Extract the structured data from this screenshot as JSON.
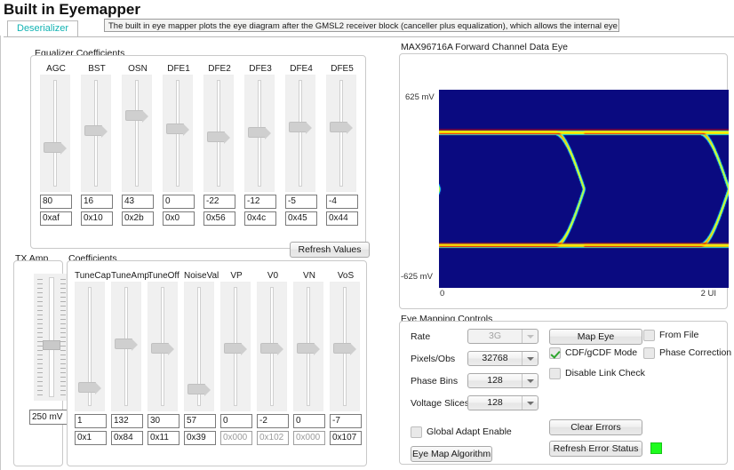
{
  "window": {
    "title": "Built in Eyemapper"
  },
  "tabs": [
    {
      "label": "Deserializer",
      "active": true
    }
  ],
  "description": "The built in eye mapper plots the eye diagram after the GMSL2 receiver block (canceller plus equalization), which allows the internal eye to be shown.",
  "equalizer": {
    "group_label": "Equalizer Coefficients",
    "channels": [
      {
        "name": "AGC",
        "dec": "80",
        "hex": "0xaf",
        "thumb_pct": 62
      },
      {
        "name": "BST",
        "dec": "16",
        "hex": "0x10",
        "thumb_pct": 46
      },
      {
        "name": "OSN",
        "dec": "43",
        "hex": "0x2b",
        "thumb_pct": 31
      },
      {
        "name": "DFE1",
        "dec": "0",
        "hex": "0x0",
        "thumb_pct": 44
      },
      {
        "name": "DFE2",
        "dec": "-22",
        "hex": "0x56",
        "thumb_pct": 52
      },
      {
        "name": "DFE3",
        "dec": "-12",
        "hex": "0x4c",
        "thumb_pct": 47
      },
      {
        "name": "DFE4",
        "dec": "-5",
        "hex": "0x45",
        "thumb_pct": 42
      },
      {
        "name": "DFE5",
        "dec": "-4",
        "hex": "0x44",
        "thumb_pct": 42
      }
    ],
    "refresh_label": "Refresh Values"
  },
  "tx_amp": {
    "group_label": "TX Amp",
    "value": "250 mV",
    "thumb_pct": 56
  },
  "coefficients": {
    "group_label": "Coefficients",
    "channels": [
      {
        "name": "TuneCap",
        "dec": "1",
        "hex": "0x1",
        "hex_dim": false,
        "thumb_pct": 84
      },
      {
        "name": "TuneAmp",
        "dec": "132",
        "hex": "0x84",
        "hex_dim": false,
        "thumb_pct": 46
      },
      {
        "name": "TuneOff",
        "dec": "30",
        "hex": "0x11",
        "hex_dim": false,
        "thumb_pct": 50
      },
      {
        "name": "NoiseVal",
        "dec": "57",
        "hex": "0x39",
        "hex_dim": false,
        "thumb_pct": 86
      },
      {
        "name": "VP",
        "dec": "0",
        "hex": "0x000",
        "hex_dim": true,
        "thumb_pct": 50
      },
      {
        "name": "V0",
        "dec": "-2",
        "hex": "0x102",
        "hex_dim": true,
        "thumb_pct": 50
      },
      {
        "name": "VN",
        "dec": "0",
        "hex": "0x000",
        "hex_dim": true,
        "thumb_pct": 50
      },
      {
        "name": "VoS",
        "dec": "-7",
        "hex": "0x107",
        "hex_dim": false,
        "thumb_pct": 50
      }
    ]
  },
  "eye_plot": {
    "title": "MAX96716A Forward Channel Data Eye",
    "y_top_label": "625 mV",
    "y_bottom_label": "-625 mV",
    "x_left_label": "0",
    "x_right_label": "2 UI",
    "background_color": "#0a0a80"
  },
  "eye_controls": {
    "group_label": "Eye Mapping Controls",
    "rows": [
      {
        "label": "Rate",
        "value": "3G",
        "disabled": true
      },
      {
        "label": "Pixels/Obs",
        "value": "32768",
        "disabled": false
      },
      {
        "label": "Phase Bins",
        "value": "128",
        "disabled": false
      },
      {
        "label": "Voltage Slices",
        "value": "128",
        "disabled": false
      }
    ],
    "buttons": {
      "map_eye": "Map Eye",
      "clear_errors": "Clear Errors",
      "refresh_error_status": "Refresh Error Status",
      "eye_map_algorithm": "Eye Map Algorithm"
    },
    "checkboxes": [
      {
        "label": "CDF/gCDF Mode",
        "checked": true
      },
      {
        "label": "Disable Link Check",
        "checked": false
      },
      {
        "label": "From File",
        "checked": false
      },
      {
        "label": "Phase Correction",
        "checked": false
      },
      {
        "label": "Global Adapt Enable",
        "checked": false
      }
    ],
    "status_color": "#1dfc1d"
  }
}
